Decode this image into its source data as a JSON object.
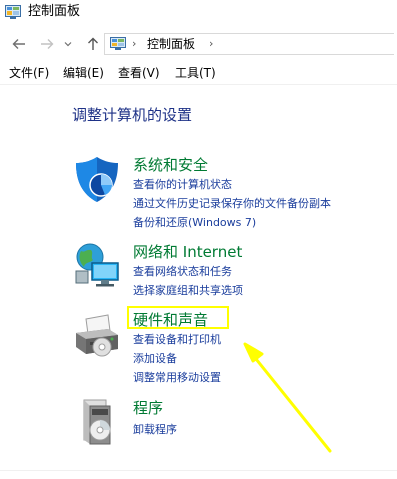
{
  "window": {
    "title": "控制面板",
    "icon": "control-panel-icon"
  },
  "nav": {
    "back_icon": "back-arrow-icon",
    "forward_icon": "forward-arrow-icon",
    "recent_icon": "chevron-down-icon",
    "up_icon": "up-arrow-icon",
    "separator": "›",
    "address": "控制面板",
    "address_separator": "›"
  },
  "menu": {
    "items": [
      {
        "label": "文件(F)"
      },
      {
        "label": "编辑(E)"
      },
      {
        "label": "查看(V)"
      },
      {
        "label": "工具(T)"
      }
    ]
  },
  "main": {
    "heading": "调整计算机的设置",
    "categories": [
      {
        "title": "系统和安全",
        "icon": "shield-icon",
        "links": [
          "查看你的计算机状态",
          "通过文件历史记录保存你的文件备份副本",
          "备份和还原(Windows 7)"
        ]
      },
      {
        "title": "网络和 Internet",
        "icon": "network-globe-icon",
        "links": [
          "查看网络状态和任务",
          "选择家庭组和共享选项"
        ]
      },
      {
        "title": "硬件和声音",
        "icon": "printer-icon",
        "links": [
          "查看设备和打印机",
          "添加设备",
          "调整常用移动设置"
        ]
      },
      {
        "title": "程序",
        "icon": "programs-disc-icon",
        "links": [
          "卸载程序"
        ]
      }
    ]
  },
  "annotation": {
    "highlight_color": "#ffff00",
    "arrow_color": "#ffff00"
  },
  "colors": {
    "heading": "#1e3287",
    "category_title": "#007a33",
    "link": "#1a3d9c"
  }
}
